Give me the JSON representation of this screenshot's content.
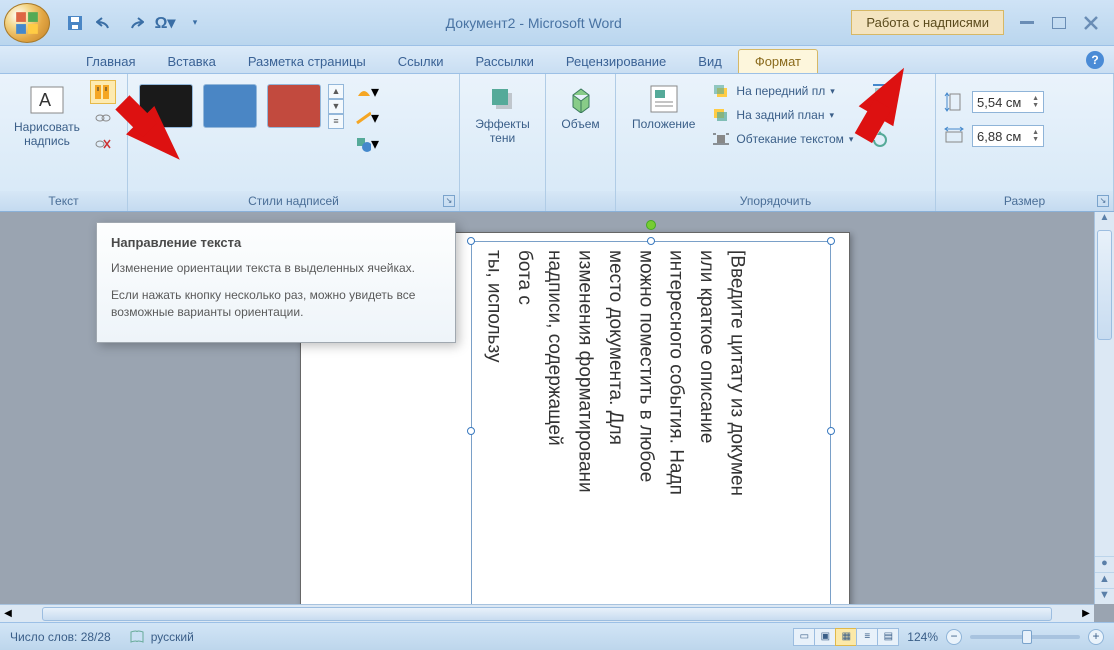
{
  "title": "Документ2 - Microsoft Word",
  "context_tab": "Работа с надписями",
  "tabs": [
    "Главная",
    "Вставка",
    "Разметка страницы",
    "Ссылки",
    "Рассылки",
    "Рецензирование",
    "Вид",
    "Формат"
  ],
  "active_tab": "Формат",
  "groups": {
    "text": {
      "label": "Текст",
      "draw": "Нарисовать\nнадпись"
    },
    "styles": {
      "label": "Стили надписей"
    },
    "shadow": {
      "label": "Эффекты\nтени"
    },
    "threeD": {
      "label": "Объем"
    },
    "position": {
      "label": "Положение"
    },
    "arrange": {
      "label": "Упорядочить",
      "front": "На передний пл",
      "back": "На задний план",
      "wrap": "Обтекание текстом"
    },
    "size": {
      "label": "Размер",
      "height": "5,54 см",
      "width": "6,88 см"
    }
  },
  "tooltip": {
    "title": "Направление текста",
    "p1": "Изменение ориентации текста в выделенных ячейках.",
    "p2": "Если нажать кнопку несколько раз, можно увидеть все возможные варианты ориентации."
  },
  "doc_text": "[Введите цитату из докумен\nили краткое описание\nинтересного события. Надп\nможно поместить в любое\nместо документа. Для\nизменения форматировани\nнадписи, содержащей\nбота с\nты, использу",
  "statusbar": {
    "words": "Число слов: 28/28",
    "lang": "русский",
    "zoom": "124%"
  }
}
